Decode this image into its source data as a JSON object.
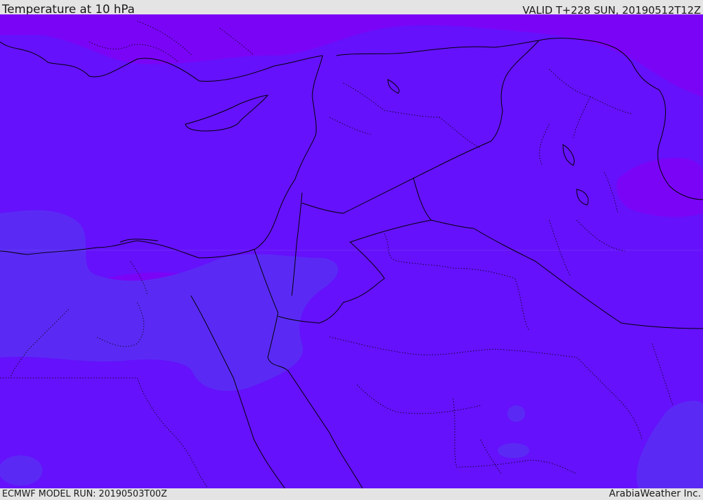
{
  "header": {
    "title": "Temperature at 10 hPa",
    "valid": "VALID T+228 SUN, 20190512T12Z"
  },
  "footer": {
    "model_run": "ECMWF MODEL RUN: 20190503T00Z",
    "credit": "ArabiaWeather Inc."
  },
  "map": {
    "region": "Eastern Mediterranean / Middle East",
    "colors": {
      "background": "#6511fb",
      "cold_band": "#7a05f6",
      "warm_band": "#5a2af4",
      "coastline": "#000000",
      "borders": "#000000"
    }
  }
}
